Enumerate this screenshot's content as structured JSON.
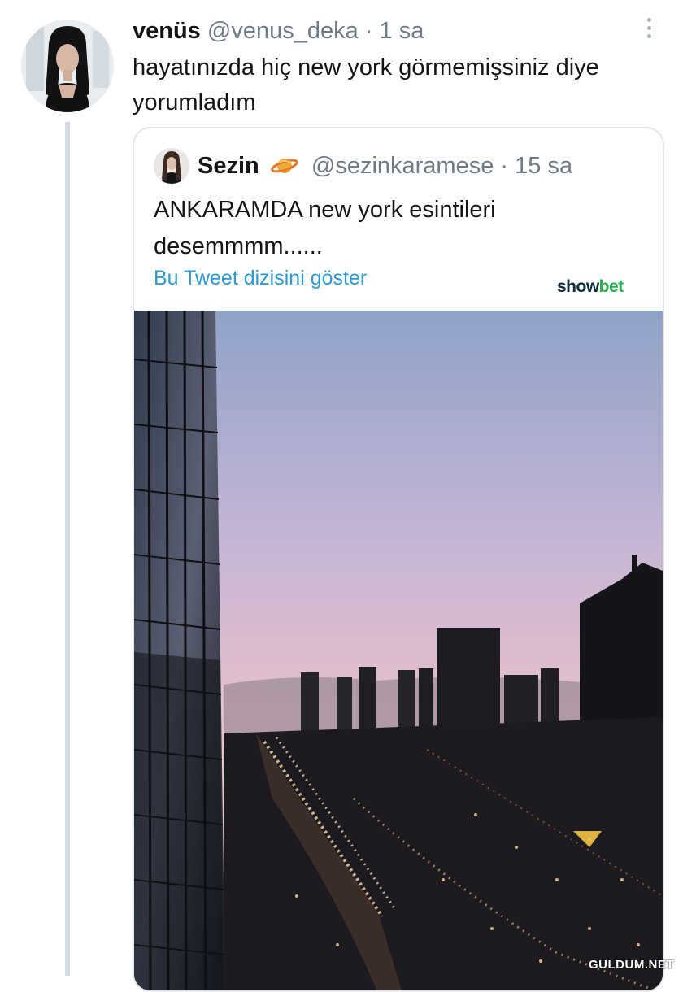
{
  "tweet": {
    "author_name": "venüs",
    "author_handle": "@venus_deka",
    "separator": "·",
    "time": "1 sa",
    "text": "hayatınızda hiç new york görmemişsiniz diye yorumladım",
    "more_icon": "more-vertical-icon"
  },
  "quote": {
    "author_name": "Sezin",
    "badge_icon": "saturn-planet-emoji",
    "author_handle": "@sezinkaramese",
    "separator": "·",
    "time": "15 sa",
    "text": "ANKARAMDA new york esintileri desemmmm......",
    "thread_link": "Bu Tweet dizisini göster",
    "media": {
      "alt": "Ankara city skyline at dusk seen from beside a glass skyscraper, with traffic below"
    }
  },
  "brand": {
    "part1": "show",
    "part2": "bet",
    "color1": "#0c2a3a",
    "color2": "#22b14c"
  },
  "watermark": "GULDUM.NET",
  "colors": {
    "link": "#2b9bd5",
    "handle": "#6e7b87",
    "thread_line": "#d3dbe2"
  }
}
